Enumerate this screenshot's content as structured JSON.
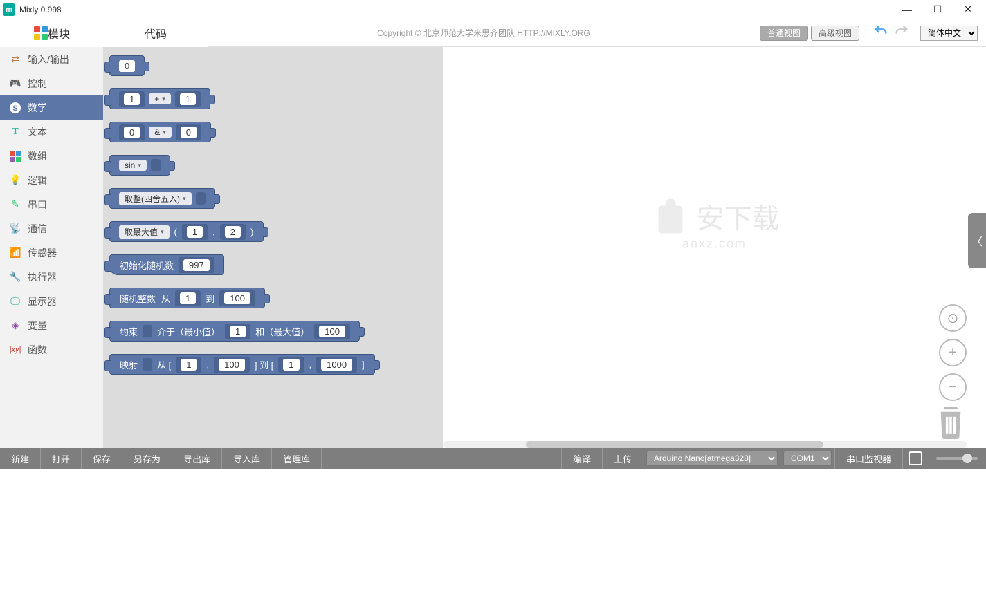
{
  "title": "Mixly 0.998",
  "tabs": {
    "modules": "模块",
    "code": "代码"
  },
  "copyright": "Copyright  ©  北京师范大学米思齐团队 HTTP://MIXLY.ORG",
  "views": {
    "normal": "普通视图",
    "advanced": "高级视图"
  },
  "language": "简体中文",
  "sidebar": {
    "items": [
      {
        "label": "输入/输出",
        "color": "#5bc0de"
      },
      {
        "label": "控制",
        "color": "#8fbf4d"
      },
      {
        "label": "数学",
        "color": "#5b76a7"
      },
      {
        "label": "文本",
        "color": "#1abc9c"
      },
      {
        "label": "数组",
        "color": "#9b59b6"
      },
      {
        "label": "逻辑",
        "color": "#3498db"
      },
      {
        "label": "串口",
        "color": "#2ecc71"
      },
      {
        "label": "通信",
        "color": "#16a085"
      },
      {
        "label": "传感器",
        "color": "#e67e22"
      },
      {
        "label": "执行器",
        "color": "#27ae60"
      },
      {
        "label": "显示器",
        "color": "#2c3e50"
      },
      {
        "label": "变量",
        "color": "#8e44ad"
      },
      {
        "label": "函数",
        "color": "#c0392b"
      }
    ],
    "activeIndex": 2
  },
  "blocks": {
    "num0": "0",
    "arith": {
      "a": "1",
      "op": "+",
      "b": "1"
    },
    "bitop": {
      "a": "0",
      "op": "&",
      "b": "0"
    },
    "trig": {
      "fn": "sin"
    },
    "round": {
      "label": "取整(四舍五入)"
    },
    "maxmin": {
      "label": "取最大值",
      "a": "1",
      "b": "2"
    },
    "seed": {
      "label": "初始化随机数",
      "v": "997"
    },
    "randint": {
      "label": "随机整数",
      "from_lbl": "从",
      "to_lbl": "到",
      "from": "1",
      "to": "100"
    },
    "constrain": {
      "label": "约束",
      "between": "介于（最小值）",
      "and": "和（最大值）",
      "min": "1",
      "max": "100"
    },
    "map": {
      "label": "映射",
      "from_lbl": "从 [",
      "sep1": ",",
      "mid": "] 到 [",
      "sep2": ",",
      "end": "]",
      "a": "1",
      "b": "100",
      "c": "1",
      "d": "1000"
    }
  },
  "watermark": {
    "text": "安下载",
    "url": "anxz.com"
  },
  "footer": {
    "buttons": [
      "新建",
      "打开",
      "保存",
      "另存为",
      "导出库",
      "导入库",
      "管理库"
    ],
    "compile": "编译",
    "upload": "上传",
    "board": "Arduino Nano[atmega328]",
    "port": "COM1",
    "monitor": "串口监视器"
  }
}
